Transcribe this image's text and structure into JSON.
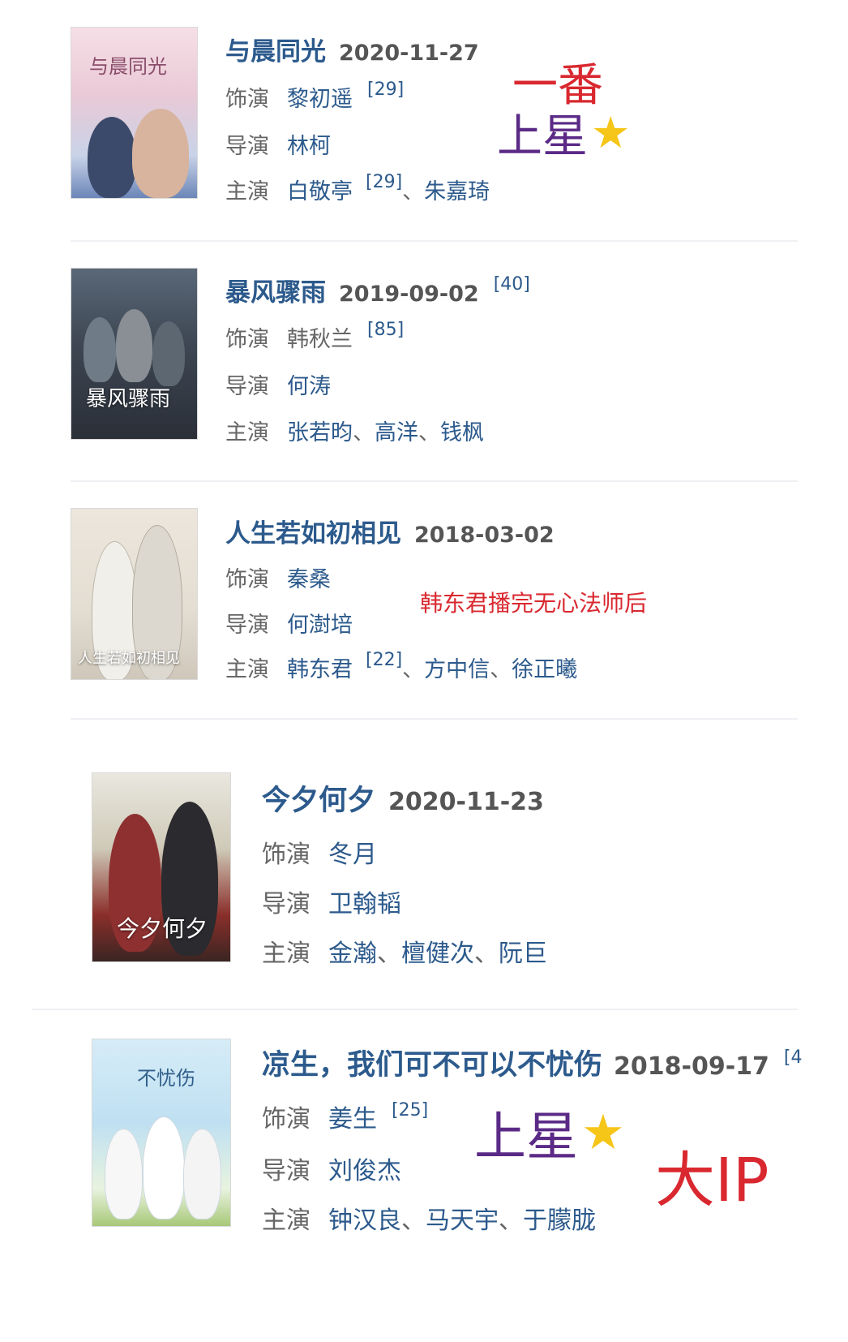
{
  "labels": {
    "role": "饰演",
    "director": "导演",
    "cast": "主演"
  },
  "entries": [
    {
      "title": "与晨同光",
      "date": "2020-11-27",
      "role": "黎初遥",
      "role_ref": "[29]",
      "director": "林柯",
      "cast": [
        "白敬亭",
        "朱嘉琦"
      ],
      "cast_ref": "[29]",
      "poster_text": "与晨同光"
    },
    {
      "title": "暴风骤雨",
      "date": "2019-09-02",
      "title_ref": "[40]",
      "role": "韩秋兰",
      "role_ref": "[85]",
      "director": "何涛",
      "cast": [
        "张若昀",
        "高洋",
        "钱枫"
      ],
      "poster_text": "暴风骤雨"
    },
    {
      "title": "人生若如初相见",
      "date": "2018-03-02",
      "role": "秦桑",
      "director": "何澍培",
      "cast": [
        "韩东君",
        "方中信",
        "徐正曦"
      ],
      "cast_ref": "[22]",
      "poster_text": "人生若如初相见"
    },
    {
      "title": "今夕何夕",
      "date": "2020-11-23",
      "role": "冬月",
      "director": "卫翰韬",
      "cast": [
        "金瀚",
        "檀健次",
        "阮巨"
      ],
      "poster_text": "今夕何夕"
    },
    {
      "title": "凉生，我们可不可以不忧伤",
      "date": "2018-09-17",
      "title_ref": "[4",
      "role": "姜生",
      "role_ref": "[25]",
      "director": "刘俊杰",
      "cast": [
        "钟汉良",
        "马天宇",
        "于朦胧"
      ],
      "poster_text": "不忧伤"
    }
  ],
  "annotations": {
    "first_lead": "一番",
    "satellite_1": "上星",
    "note": "韩东君播完无心法师后",
    "satellite_2": "上星",
    "big_ip": "大IP"
  },
  "colors": {
    "title": "#2c5a8c",
    "label": "#666666",
    "annotation_red": "#d9282f",
    "annotation_purple": "#5b2a86",
    "star": "#f5c518"
  }
}
